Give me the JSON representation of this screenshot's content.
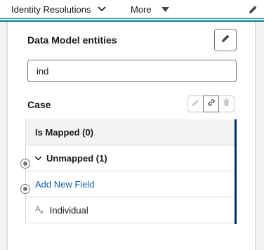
{
  "topbar": {
    "tab_identity": "Identity Resolutions",
    "tab_more": "More"
  },
  "panel": {
    "section_title": "Data Model entities",
    "search": {
      "value": "ind",
      "placeholder": ""
    },
    "object_title": "Case",
    "list": {
      "mapped_label": "Is Mapped (0)",
      "unmapped_label": "Unmapped (1)",
      "add_field_label": "Add New Field",
      "fields": [
        {
          "type_icon": "Aa",
          "label": "Individual"
        }
      ]
    }
  },
  "colors": {
    "accent_teal": "#0b827c",
    "link_blue": "#0b5cab",
    "list_edge_navy": "#032d60"
  }
}
